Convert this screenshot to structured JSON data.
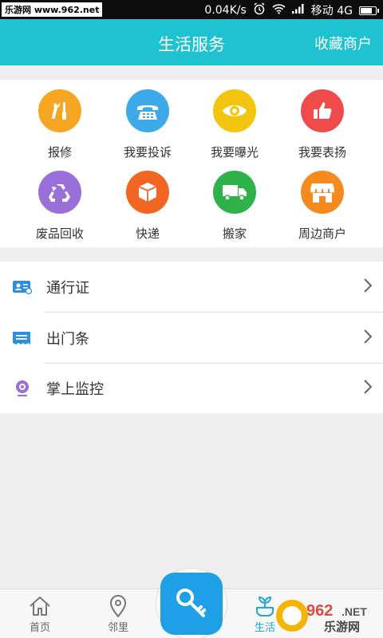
{
  "status_bar": {
    "watermark": "乐游网 www.962.net",
    "speed": "0.04K/s",
    "carrier": "移动 4G"
  },
  "header": {
    "title": "生活服务",
    "right_action": "收藏商户",
    "color": "#1fc2d0"
  },
  "services": [
    {
      "label": "报修",
      "icon": "wrench-screwdriver-icon",
      "color": "#f6a623"
    },
    {
      "label": "我要投诉",
      "icon": "telephone-icon",
      "color": "#3ea9e8"
    },
    {
      "label": "我要曝光",
      "icon": "eye-icon",
      "color": "#f2c50f"
    },
    {
      "label": "我要表扬",
      "icon": "thumbs-up-icon",
      "color": "#ef4b4b"
    },
    {
      "label": "废品回收",
      "icon": "recycle-icon",
      "color": "#9b6fd9"
    },
    {
      "label": "快递",
      "icon": "package-icon",
      "color": "#f26522"
    },
    {
      "label": "搬家",
      "icon": "truck-icon",
      "color": "#2fb24a"
    },
    {
      "label": "周边商户",
      "icon": "storefront-icon",
      "color": "#f58a1f"
    }
  ],
  "list": [
    {
      "label": "通行证",
      "icon": "id-card-icon"
    },
    {
      "label": "出门条",
      "icon": "ticket-icon"
    },
    {
      "label": "掌上监控",
      "icon": "camera-icon"
    }
  ],
  "tabbar": {
    "home": "首页",
    "neighbors": "邻里",
    "life": "生活",
    "key_icon": "key-icon",
    "watermark_logo": "962.NET 乐游网"
  }
}
